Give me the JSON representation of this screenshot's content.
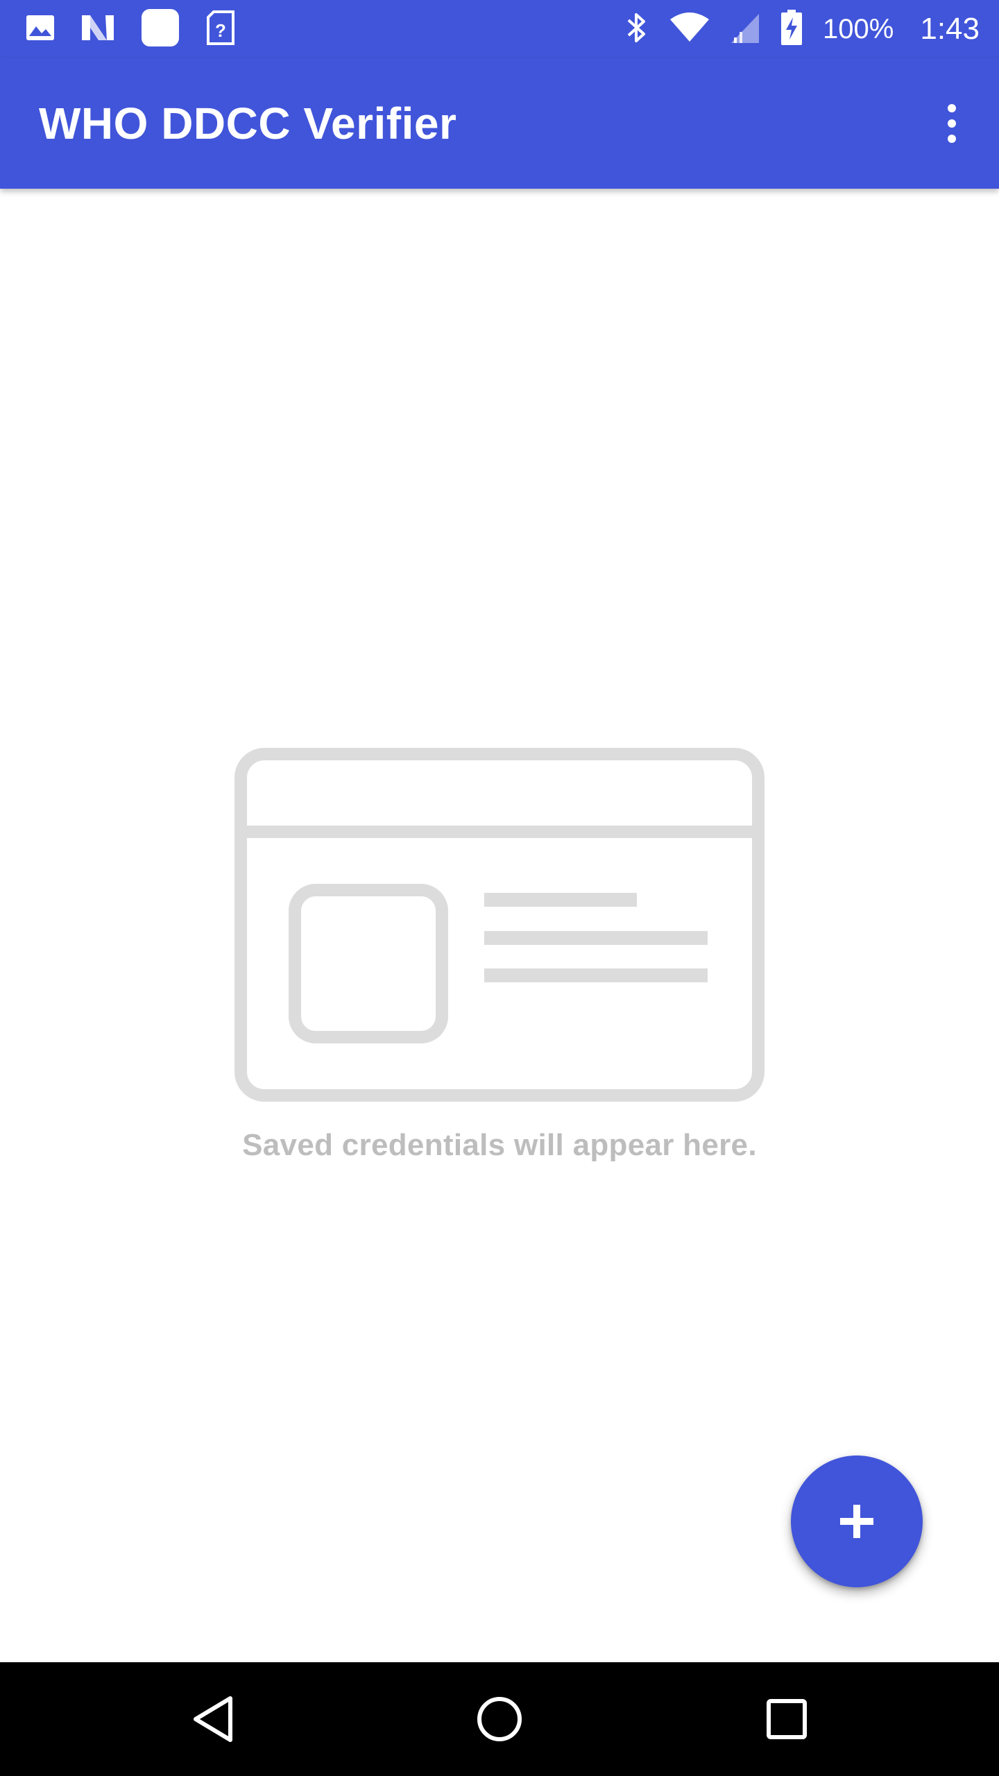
{
  "status_bar": {
    "battery_level": "100%",
    "time": "1:43",
    "notification_icons": [
      "image-icon",
      "n-logo-icon",
      "square-app-icon",
      "sim-unknown-icon"
    ],
    "system_icons": [
      "bluetooth-icon",
      "wifi-icon",
      "signal-icon",
      "battery-charging-icon"
    ]
  },
  "app_bar": {
    "title": "WHO DDCC Verifier",
    "menu_icon": "more-vert-icon"
  },
  "empty_state": {
    "illustration_icon": "id-card-placeholder-icon",
    "message": "Saved credentials will appear here."
  },
  "fab": {
    "icon": "plus-icon",
    "action": "add"
  },
  "nav_bar": {
    "buttons": [
      "back-icon",
      "home-icon",
      "recents-icon"
    ]
  },
  "colors": {
    "primary": "#4155DA",
    "illustration": "#DCDCDC",
    "empty_text": "#BDBDBD",
    "nav_background": "#000000"
  }
}
